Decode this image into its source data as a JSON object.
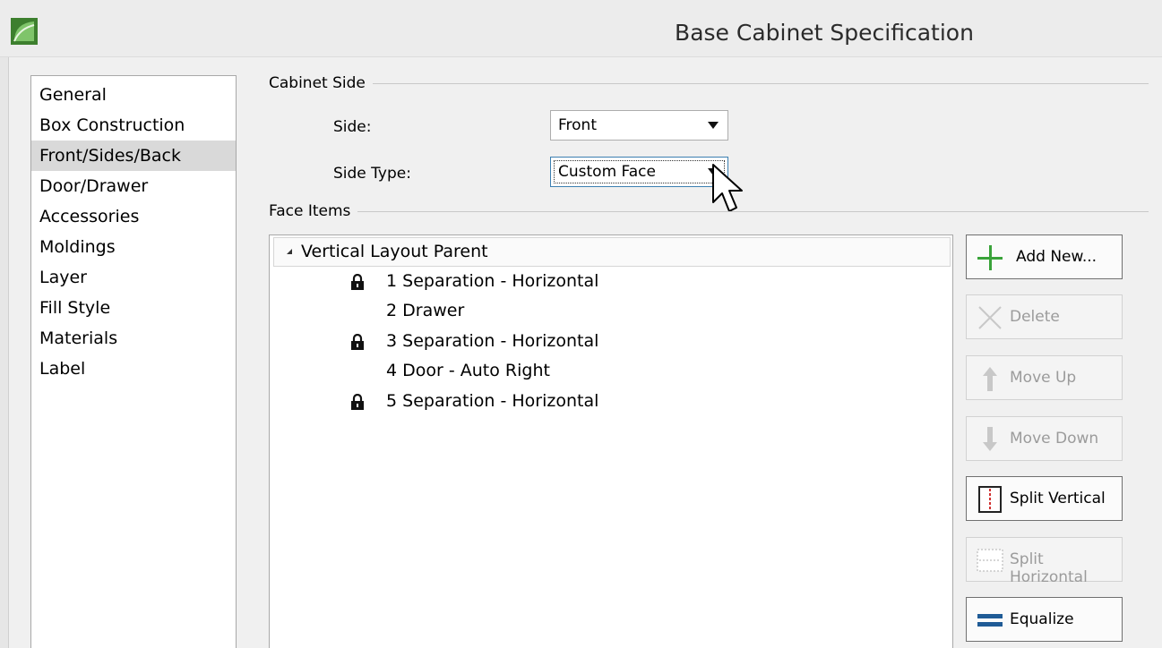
{
  "window": {
    "title": "Base Cabinet Specification"
  },
  "sidebar": {
    "items": [
      {
        "label": "General"
      },
      {
        "label": "Box Construction"
      },
      {
        "label": "Front/Sides/Back",
        "selected": true
      },
      {
        "label": "Door/Drawer"
      },
      {
        "label": "Accessories"
      },
      {
        "label": "Moldings"
      },
      {
        "label": "Layer"
      },
      {
        "label": "Fill Style"
      },
      {
        "label": "Materials"
      },
      {
        "label": "Label"
      }
    ]
  },
  "cabinet_side": {
    "group_label": "Cabinet Side",
    "side_label": "Side:",
    "side_value": "Front",
    "side_type_label": "Side Type:",
    "side_type_value": "Custom Face"
  },
  "face_items": {
    "group_label": "Face Items",
    "parent_label": "Vertical Layout Parent",
    "items": [
      {
        "label": "1 Separation - Horizontal",
        "locked": true
      },
      {
        "label": "2 Drawer",
        "locked": false
      },
      {
        "label": "3 Separation - Horizontal",
        "locked": true
      },
      {
        "label": "4 Door - Auto Right",
        "locked": false
      },
      {
        "label": "5 Separation - Horizontal",
        "locked": true
      }
    ]
  },
  "buttons": {
    "add_new": "Add New...",
    "delete": "Delete",
    "move_up": "Move Up",
    "move_down": "Move Down",
    "split_vertical": "Split Vertical",
    "split_horizontal": "Split Horizontal",
    "equalize": "Equalize"
  },
  "icons": {
    "app": "app-logo-icon",
    "lock": "lock-icon",
    "add": "plus-icon",
    "delete": "x-icon",
    "move_up": "arrow-up-icon",
    "move_down": "arrow-down-icon",
    "split_vertical": "split-vertical-icon",
    "split_horizontal": "split-horizontal-icon",
    "equalize": "equalize-icon"
  },
  "colors": {
    "accent_green": "#3aa33a",
    "equalize_blue": "#1f5b96",
    "split_red": "#d03030",
    "selection_gray": "#d9d9d9"
  }
}
